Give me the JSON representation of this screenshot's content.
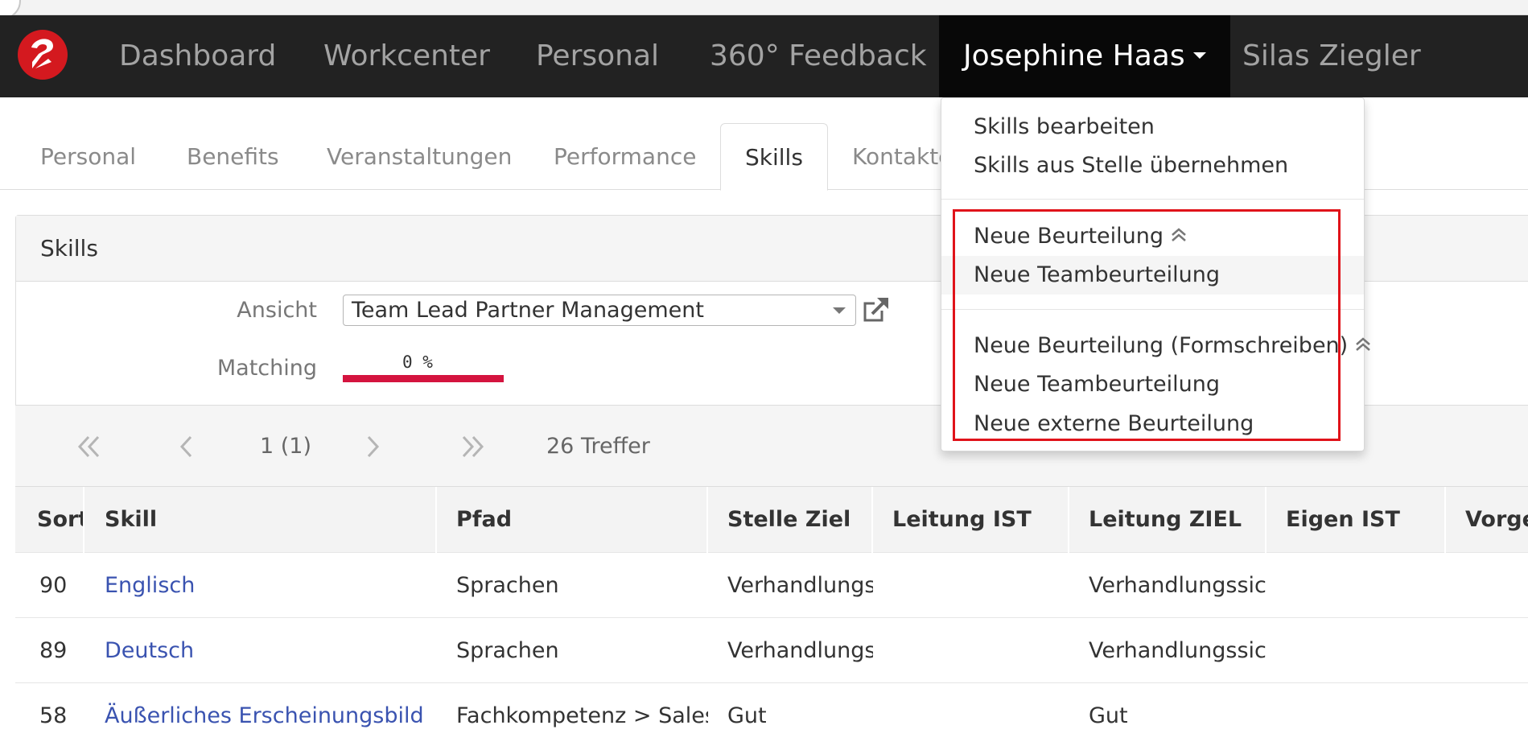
{
  "navbar": {
    "items": [
      "Dashboard",
      "Workcenter",
      "Personal",
      "360° Feedback"
    ],
    "active_user": "Josephine Haas",
    "other_user": "Silas Ziegler"
  },
  "tabs": [
    "Personal",
    "Benefits",
    "Veranstaltungen",
    "Performance",
    "Skills",
    "Kontakte"
  ],
  "active_tab": "Skills",
  "panel": {
    "title": "Skills",
    "ansicht_label": "Ansicht",
    "ansicht_value": "Team Lead Partner Management",
    "matching_label": "Matching",
    "matching_value": "0 %",
    "matching_fraction": 0
  },
  "pager": {
    "page": "1 (1)",
    "hits": "26 Treffer"
  },
  "table": {
    "headers": [
      "Sorti",
      "Skill",
      "Pfad",
      "Stelle Ziel",
      "Leitung IST",
      "Leitung ZIEL",
      "Eigen IST",
      "Vorges"
    ],
    "rows": [
      [
        "90",
        "Englisch",
        "Sprachen",
        "Verhandlungss",
        "",
        "Verhandlungssich",
        "",
        ""
      ],
      [
        "89",
        "Deutsch",
        "Sprachen",
        "Verhandlungss",
        "",
        "Verhandlungssich",
        "",
        ""
      ],
      [
        "58",
        "Äußerliches Erscheinungsbild",
        "Fachkompetenz > Sales / I",
        "Gut",
        "",
        "Gut",
        "",
        ""
      ]
    ]
  },
  "dropdown": {
    "group1": [
      "Skills bearbeiten",
      "Skills aus Stelle übernehmen"
    ],
    "group2": [
      "Neue Beurteilung",
      "Neue Teambeurteilung"
    ],
    "group3": [
      "Neue Beurteilung (Formschreiben)",
      "Neue Teambeurteilung",
      "Neue externe Beurteilung"
    ]
  },
  "colors": {
    "navbar_bg": "#222222",
    "accent_red": "#d4191f",
    "link": "#3a53b0",
    "highlight": "#e0131a"
  }
}
